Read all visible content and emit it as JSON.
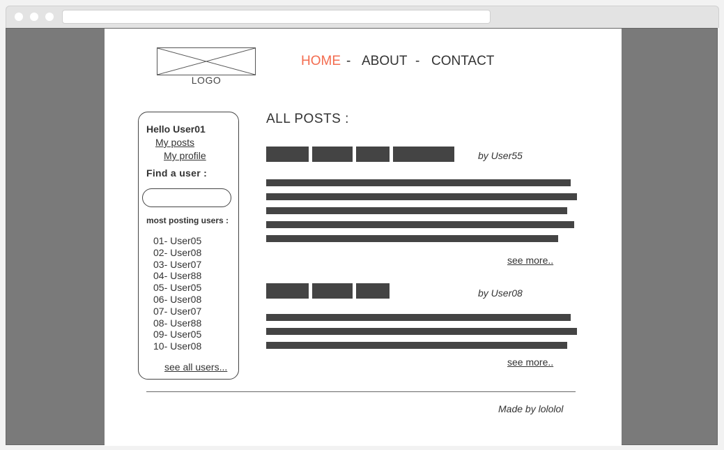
{
  "logo": {
    "label": "LOGO"
  },
  "nav": {
    "home": "HOME",
    "about": "ABOUT",
    "contact": "CONTACT",
    "separator": "-",
    "active_color": "#f36c4f"
  },
  "sidebar": {
    "greeting": "Hello User01",
    "my_posts": "My posts",
    "my_profile": "My profile",
    "find_user": "Find a user :",
    "search_value": "",
    "most_posting": "most posting users :",
    "users": [
      "01- User05",
      "02- User08",
      "03- User07",
      "04- User88",
      "05- User05",
      "06- User08",
      "07- User07",
      "08- User88",
      "09- User05",
      "10- User08"
    ],
    "see_all": "see all users..."
  },
  "main": {
    "title": "ALL POSTS :",
    "posts": [
      {
        "author": "by User55",
        "see_more": "see more.."
      },
      {
        "author": "by User08",
        "see_more": "see more.."
      }
    ]
  },
  "footer": {
    "text": "Made by lololol"
  }
}
